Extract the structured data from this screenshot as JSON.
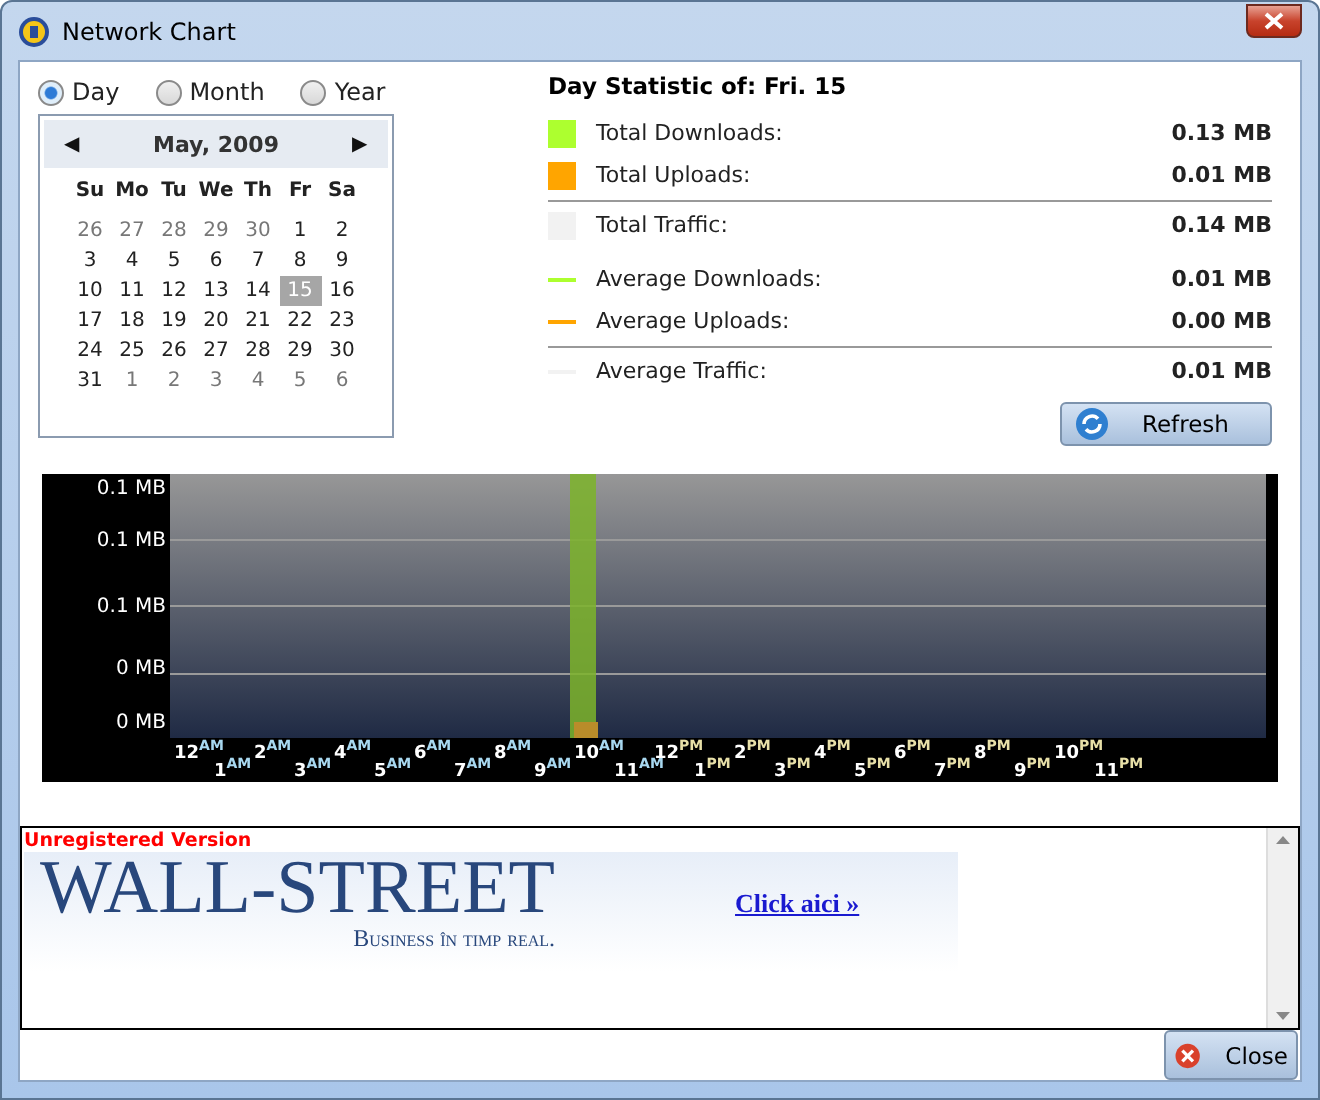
{
  "window": {
    "title": "Network Chart"
  },
  "period_options": [
    {
      "label": "Day",
      "selected": true
    },
    {
      "label": "Month",
      "selected": false
    },
    {
      "label": "Year",
      "selected": false
    }
  ],
  "calendar": {
    "month": "May, 2009",
    "prev": "◀",
    "next": "▶",
    "weekdays": [
      "Su",
      "Mo",
      "Tu",
      "We",
      "Th",
      "Fr",
      "Sa"
    ],
    "days": [
      {
        "label": "26",
        "other_month": true,
        "selected": false
      },
      {
        "label": "27",
        "other_month": true,
        "selected": false
      },
      {
        "label": "28",
        "other_month": true,
        "selected": false
      },
      {
        "label": "29",
        "other_month": true,
        "selected": false
      },
      {
        "label": "30",
        "other_month": true,
        "selected": false
      },
      {
        "label": "1",
        "other_month": false,
        "selected": false
      },
      {
        "label": "2",
        "other_month": false,
        "selected": false
      },
      {
        "label": "3",
        "other_month": false,
        "selected": false
      },
      {
        "label": "4",
        "other_month": false,
        "selected": false
      },
      {
        "label": "5",
        "other_month": false,
        "selected": false
      },
      {
        "label": "6",
        "other_month": false,
        "selected": false
      },
      {
        "label": "7",
        "other_month": false,
        "selected": false
      },
      {
        "label": "8",
        "other_month": false,
        "selected": false
      },
      {
        "label": "9",
        "other_month": false,
        "selected": false
      },
      {
        "label": "10",
        "other_month": false,
        "selected": false
      },
      {
        "label": "11",
        "other_month": false,
        "selected": false
      },
      {
        "label": "12",
        "other_month": false,
        "selected": false
      },
      {
        "label": "13",
        "other_month": false,
        "selected": false
      },
      {
        "label": "14",
        "other_month": false,
        "selected": false
      },
      {
        "label": "15",
        "other_month": false,
        "selected": true
      },
      {
        "label": "16",
        "other_month": false,
        "selected": false
      },
      {
        "label": "17",
        "other_month": false,
        "selected": false
      },
      {
        "label": "18",
        "other_month": false,
        "selected": false
      },
      {
        "label": "19",
        "other_month": false,
        "selected": false
      },
      {
        "label": "20",
        "other_month": false,
        "selected": false
      },
      {
        "label": "21",
        "other_month": false,
        "selected": false
      },
      {
        "label": "22",
        "other_month": false,
        "selected": false
      },
      {
        "label": "23",
        "other_month": false,
        "selected": false
      },
      {
        "label": "24",
        "other_month": false,
        "selected": false
      },
      {
        "label": "25",
        "other_month": false,
        "selected": false
      },
      {
        "label": "26",
        "other_month": false,
        "selected": false
      },
      {
        "label": "27",
        "other_month": false,
        "selected": false
      },
      {
        "label": "28",
        "other_month": false,
        "selected": false
      },
      {
        "label": "29",
        "other_month": false,
        "selected": false
      },
      {
        "label": "30",
        "other_month": false,
        "selected": false
      },
      {
        "label": "31",
        "other_month": false,
        "selected": false
      },
      {
        "label": "1",
        "other_month": true,
        "selected": false
      },
      {
        "label": "2",
        "other_month": true,
        "selected": false
      },
      {
        "label": "3",
        "other_month": true,
        "selected": false
      },
      {
        "label": "4",
        "other_month": true,
        "selected": false
      },
      {
        "label": "5",
        "other_month": true,
        "selected": false
      },
      {
        "label": "6",
        "other_month": true,
        "selected": false
      }
    ]
  },
  "statistics": {
    "title": "Day Statistic of: Fri. 15",
    "rows": [
      {
        "kind": "swatch",
        "color": "#adff2f",
        "label": "Total Downloads:",
        "value": "0.13 MB",
        "rule_after": false
      },
      {
        "kind": "swatch",
        "color": "#ffa500",
        "label": "Total Uploads:",
        "value": "0.01 MB",
        "rule_after": true
      },
      {
        "kind": "swatch",
        "color": "#f2f2f2",
        "label": "Total Traffic:",
        "value": "0.14 MB",
        "rule_after": false
      },
      {
        "kind": "line",
        "color": "#adff2f",
        "label": "Average Downloads:",
        "value": "0.01 MB",
        "rule_after": false
      },
      {
        "kind": "line",
        "color": "#ffa500",
        "label": "Average Uploads:",
        "value": "0.00 MB",
        "rule_after": true
      },
      {
        "kind": "line",
        "color": "#f2f2f2",
        "label": "Average Traffic:",
        "value": "0.01 MB",
        "rule_after": false
      }
    ],
    "refresh_button": "Refresh"
  },
  "chart": {
    "y_labels": [
      "0.1 MB",
      "0.1 MB",
      "0.1 MB",
      "0 MB",
      "0 MB"
    ],
    "hours": [
      {
        "hour": "12",
        "suffix": "AM",
        "has_traffic": false
      },
      {
        "hour": "1",
        "suffix": "AM",
        "has_traffic": false
      },
      {
        "hour": "2",
        "suffix": "AM",
        "has_traffic": false
      },
      {
        "hour": "3",
        "suffix": "AM",
        "has_traffic": false
      },
      {
        "hour": "4",
        "suffix": "AM",
        "has_traffic": false
      },
      {
        "hour": "5",
        "suffix": "AM",
        "has_traffic": false
      },
      {
        "hour": "6",
        "suffix": "AM",
        "has_traffic": false
      },
      {
        "hour": "7",
        "suffix": "AM",
        "has_traffic": false
      },
      {
        "hour": "8",
        "suffix": "AM",
        "has_traffic": false
      },
      {
        "hour": "9",
        "suffix": "AM",
        "has_traffic": false
      },
      {
        "hour": "10",
        "suffix": "AM",
        "has_traffic": true
      },
      {
        "hour": "11",
        "suffix": "AM",
        "has_traffic": false
      },
      {
        "hour": "12",
        "suffix": "PM",
        "has_traffic": false
      },
      {
        "hour": "1",
        "suffix": "PM",
        "has_traffic": false
      },
      {
        "hour": "2",
        "suffix": "PM",
        "has_traffic": false
      },
      {
        "hour": "3",
        "suffix": "PM",
        "has_traffic": false
      },
      {
        "hour": "4",
        "suffix": "PM",
        "has_traffic": false
      },
      {
        "hour": "5",
        "suffix": "PM",
        "has_traffic": false
      },
      {
        "hour": "6",
        "suffix": "PM",
        "has_traffic": false
      },
      {
        "hour": "7",
        "suffix": "PM",
        "has_traffic": false
      },
      {
        "hour": "8",
        "suffix": "PM",
        "has_traffic": false
      },
      {
        "hour": "9",
        "suffix": "PM",
        "has_traffic": false
      },
      {
        "hour": "10",
        "suffix": "PM",
        "has_traffic": false
      },
      {
        "hour": "11",
        "suffix": "PM",
        "has_traffic": false
      }
    ]
  },
  "ad_panel": {
    "notice": "Unregistered Version",
    "headline": "WALL-STREET",
    "tagline": "Business în timp real.",
    "link": "Click aici »"
  },
  "close_button": "Close"
}
